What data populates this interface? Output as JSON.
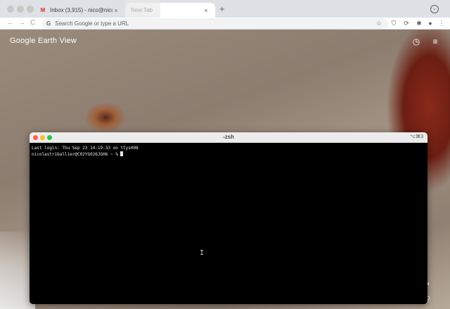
{
  "browser": {
    "tabs": [
      {
        "title": "Inbox (3,915) - nico@nicopower...",
        "favicon": "gmail-icon",
        "close": "×"
      },
      {
        "title": "New Tab",
        "favicon": "earth-view-icon",
        "close": "×"
      }
    ],
    "new_tab": "+",
    "omnibox_placeholder": "Search Google or type a URL",
    "nav": {
      "back": "←",
      "forward": "→",
      "reload": "C"
    }
  },
  "earth_view": {
    "logo_brand": "Google",
    "logo_product": "Earth View",
    "icons": [
      "history-icon",
      "menu-icon"
    ]
  },
  "terminal": {
    "title": "-zsh",
    "shortcut": "⌥⌘3",
    "lines": [
      "Last login: Thu Sep 23 14:19:33 on ttys008",
      "nicolastriballier@C02YG026JGH6 ~ % "
    ]
  },
  "colors": {
    "terminal_bg": "#000000",
    "titlebar": "#ececec",
    "close": "#ff5f57",
    "minimize": "#febc2e",
    "zoom": "#28c840",
    "soil": "#9a8a7c",
    "red_ground": "#8a2a1a"
  }
}
